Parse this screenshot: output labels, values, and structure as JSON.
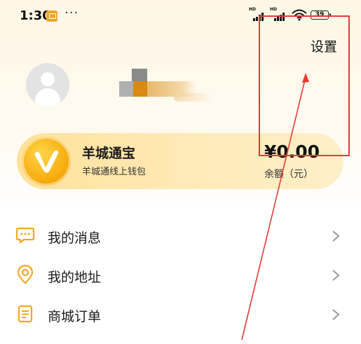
{
  "status_bar": {
    "time": "1:30",
    "more": "···",
    "network_1": "HD",
    "network_2": "HD",
    "battery": "39"
  },
  "header": {
    "settings_label": "设置"
  },
  "profile": {
    "avatar_icon": "default-user-avatar"
  },
  "wallet": {
    "title": "羊城通宝",
    "subtitle": "羊城通线上钱包",
    "balance": "¥0.00",
    "balance_label": "余额（元）",
    "logo_icon": "v-logo-icon"
  },
  "menu": {
    "items": [
      {
        "label": "我的消息",
        "icon": "message-icon"
      },
      {
        "label": "我的地址",
        "icon": "location-icon"
      },
      {
        "label": "商城订单",
        "icon": "order-icon"
      }
    ]
  },
  "colors": {
    "accent": "#f5a623",
    "annotation": "#e53935",
    "wallet_bg": "#ffe29a"
  }
}
